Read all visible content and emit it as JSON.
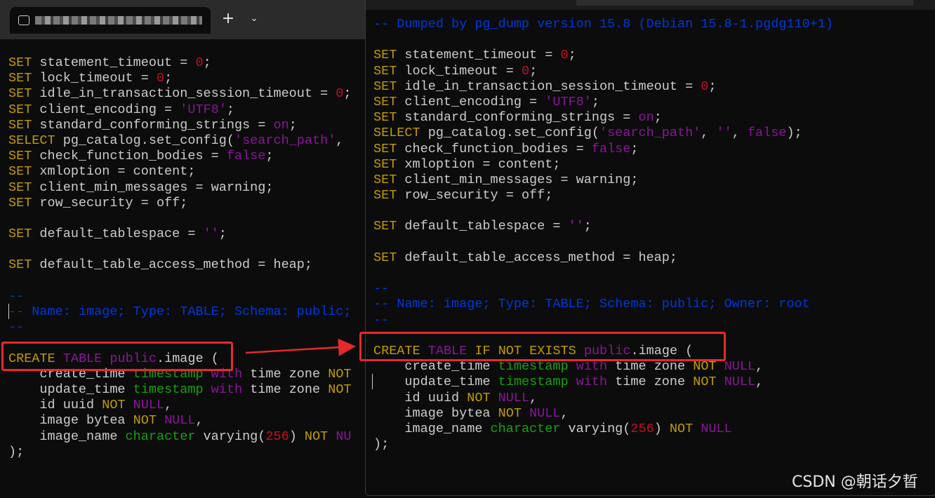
{
  "tabbar": {
    "tab_title": "████████████████████",
    "new_tab_label": "+",
    "dropdown_label": "⌄"
  },
  "colors": {
    "keyword": "#c19c00",
    "number": "#c50f1f",
    "string": "#881798",
    "type": "#13a10e",
    "comment": "#0037da",
    "text": "#cccccc",
    "highlight_box": "#e8282a"
  },
  "left_terminal": {
    "lines": [
      [
        [
          "kw",
          "SET"
        ],
        [
          "t",
          " statement_timeout = "
        ],
        [
          "num",
          "0"
        ],
        [
          "t",
          ";"
        ]
      ],
      [
        [
          "kw",
          "SET"
        ],
        [
          "t",
          " lock_timeout = "
        ],
        [
          "num",
          "0"
        ],
        [
          "t",
          ";"
        ]
      ],
      [
        [
          "kw",
          "SET"
        ],
        [
          "t",
          " idle_in_transaction_session_timeout = "
        ],
        [
          "num",
          "0"
        ],
        [
          "t",
          ";"
        ]
      ],
      [
        [
          "kw",
          "SET"
        ],
        [
          "t",
          " client_encoding = "
        ],
        [
          "str",
          "'UTF8'"
        ],
        [
          "t",
          ";"
        ]
      ],
      [
        [
          "kw",
          "SET"
        ],
        [
          "t",
          " standard_conforming_strings = "
        ],
        [
          "str",
          "on"
        ],
        [
          "t",
          ";"
        ]
      ],
      [
        [
          "kw",
          "SELECT"
        ],
        [
          "t",
          " pg_catalog.set_config("
        ],
        [
          "str",
          "'search_path'"
        ],
        [
          "t",
          ","
        ]
      ],
      [
        [
          "kw",
          "SET"
        ],
        [
          "t",
          " check_function_bodies = "
        ],
        [
          "str",
          "false"
        ],
        [
          "t",
          ";"
        ]
      ],
      [
        [
          "kw",
          "SET"
        ],
        [
          "t",
          " xmloption = content;"
        ]
      ],
      [
        [
          "kw",
          "SET"
        ],
        [
          "t",
          " client_min_messages = warning;"
        ]
      ],
      [
        [
          "kw",
          "SET"
        ],
        [
          "t",
          " row_security = off;"
        ]
      ],
      [],
      [
        [
          "kw",
          "SET"
        ],
        [
          "t",
          " default_tablespace = "
        ],
        [
          "str",
          "''"
        ],
        [
          "t",
          ";"
        ]
      ],
      [],
      [
        [
          "kw",
          "SET"
        ],
        [
          "t",
          " default_table_access_method = heap;"
        ]
      ],
      [],
      [
        [
          "cmt",
          "--"
        ]
      ],
      [
        [
          "cmt",
          "-- Name: image; Type: TABLE; Schema: public;"
        ]
      ],
      [
        [
          "cmt",
          "--"
        ]
      ],
      [],
      [
        [
          "kw",
          "CREATE"
        ],
        [
          "t",
          " "
        ],
        [
          "str",
          "TABLE"
        ],
        [
          "t",
          " "
        ],
        [
          "str",
          "public"
        ],
        [
          "t",
          ".image ("
        ]
      ],
      [
        [
          "t",
          "    create_time "
        ],
        [
          "typ",
          "timestamp"
        ],
        [
          "t",
          " "
        ],
        [
          "str",
          "with"
        ],
        [
          "t",
          " time zone "
        ],
        [
          "kw",
          "NOT"
        ]
      ],
      [
        [
          "t",
          "    update_time "
        ],
        [
          "typ",
          "timestamp"
        ],
        [
          "t",
          " "
        ],
        [
          "str",
          "with"
        ],
        [
          "t",
          " time zone "
        ],
        [
          "kw",
          "NOT"
        ]
      ],
      [
        [
          "t",
          "    id uuid "
        ],
        [
          "kw",
          "NOT"
        ],
        [
          "t",
          " "
        ],
        [
          "str",
          "NULL"
        ],
        [
          "t",
          ","
        ]
      ],
      [
        [
          "t",
          "    image bytea "
        ],
        [
          "kw",
          "NOT"
        ],
        [
          "t",
          " "
        ],
        [
          "str",
          "NULL"
        ],
        [
          "t",
          ","
        ]
      ],
      [
        [
          "t",
          "    image_name "
        ],
        [
          "typ",
          "character"
        ],
        [
          "t",
          " varying("
        ],
        [
          "num",
          "256"
        ],
        [
          "t",
          ") "
        ],
        [
          "kw",
          "NOT"
        ],
        [
          "t",
          " "
        ],
        [
          "str",
          "NU"
        ]
      ],
      [
        [
          "t",
          ");"
        ]
      ]
    ]
  },
  "right_terminal": {
    "lines": [
      [
        [
          "cmt",
          "-- Dumped by pg_dump version 15.8 (Debian 15.8-1.pgdg110+1)"
        ]
      ],
      [],
      [
        [
          "kw",
          "SET"
        ],
        [
          "t",
          " statement_timeout = "
        ],
        [
          "num",
          "0"
        ],
        [
          "t",
          ";"
        ]
      ],
      [
        [
          "kw",
          "SET"
        ],
        [
          "t",
          " lock_timeout = "
        ],
        [
          "num",
          "0"
        ],
        [
          "t",
          ";"
        ]
      ],
      [
        [
          "kw",
          "SET"
        ],
        [
          "t",
          " idle_in_transaction_session_timeout = "
        ],
        [
          "num",
          "0"
        ],
        [
          "t",
          ";"
        ]
      ],
      [
        [
          "kw",
          "SET"
        ],
        [
          "t",
          " client_encoding = "
        ],
        [
          "str",
          "'UTF8'"
        ],
        [
          "t",
          ";"
        ]
      ],
      [
        [
          "kw",
          "SET"
        ],
        [
          "t",
          " standard_conforming_strings = "
        ],
        [
          "str",
          "on"
        ],
        [
          "t",
          ";"
        ]
      ],
      [
        [
          "kw",
          "SELECT"
        ],
        [
          "t",
          " pg_catalog.set_config("
        ],
        [
          "str",
          "'search_path'"
        ],
        [
          "t",
          ", "
        ],
        [
          "str",
          "''"
        ],
        [
          "t",
          ", "
        ],
        [
          "str",
          "false"
        ],
        [
          "t",
          ");"
        ]
      ],
      [
        [
          "kw",
          "SET"
        ],
        [
          "t",
          " check_function_bodies = "
        ],
        [
          "str",
          "false"
        ],
        [
          "t",
          ";"
        ]
      ],
      [
        [
          "kw",
          "SET"
        ],
        [
          "t",
          " xmloption = content;"
        ]
      ],
      [
        [
          "kw",
          "SET"
        ],
        [
          "t",
          " client_min_messages = warning;"
        ]
      ],
      [
        [
          "kw",
          "SET"
        ],
        [
          "t",
          " row_security = off;"
        ]
      ],
      [],
      [
        [
          "kw",
          "SET"
        ],
        [
          "t",
          " default_tablespace = "
        ],
        [
          "str",
          "''"
        ],
        [
          "t",
          ";"
        ]
      ],
      [],
      [
        [
          "kw",
          "SET"
        ],
        [
          "t",
          " default_table_access_method = heap;"
        ]
      ],
      [],
      [
        [
          "cmt",
          "--"
        ]
      ],
      [
        [
          "cmt",
          "-- Name: image; Type: TABLE; Schema: public; Owner: root"
        ]
      ],
      [
        [
          "cmt",
          "--"
        ]
      ],
      [],
      [
        [
          "kw",
          "CREATE"
        ],
        [
          "t",
          " "
        ],
        [
          "str",
          "TABLE"
        ],
        [
          "t",
          " "
        ],
        [
          "kw",
          "IF"
        ],
        [
          "t",
          " "
        ],
        [
          "kw",
          "NOT"
        ],
        [
          "t",
          " "
        ],
        [
          "kw",
          "EXISTS"
        ],
        [
          "t",
          " "
        ],
        [
          "str",
          "public"
        ],
        [
          "t",
          ".image ("
        ]
      ],
      [
        [
          "t",
          "    create_time "
        ],
        [
          "typ",
          "timestamp"
        ],
        [
          "t",
          " "
        ],
        [
          "str",
          "with"
        ],
        [
          "t",
          " time zone "
        ],
        [
          "kw",
          "NOT"
        ],
        [
          "t",
          " "
        ],
        [
          "str",
          "NULL"
        ],
        [
          "t",
          ","
        ]
      ],
      [
        [
          "t",
          "    update_time "
        ],
        [
          "typ",
          "timestamp"
        ],
        [
          "t",
          " "
        ],
        [
          "str",
          "with"
        ],
        [
          "t",
          " time zone "
        ],
        [
          "kw",
          "NOT"
        ],
        [
          "t",
          " "
        ],
        [
          "str",
          "NULL"
        ],
        [
          "t",
          ","
        ]
      ],
      [
        [
          "t",
          "    id uuid "
        ],
        [
          "kw",
          "NOT"
        ],
        [
          "t",
          " "
        ],
        [
          "str",
          "NULL"
        ],
        [
          "t",
          ","
        ]
      ],
      [
        [
          "t",
          "    image bytea "
        ],
        [
          "kw",
          "NOT"
        ],
        [
          "t",
          " "
        ],
        [
          "str",
          "NULL"
        ],
        [
          "t",
          ","
        ]
      ],
      [
        [
          "t",
          "    image_name "
        ],
        [
          "typ",
          "character"
        ],
        [
          "t",
          " varying("
        ],
        [
          "num",
          "256"
        ],
        [
          "t",
          ") "
        ],
        [
          "kw",
          "NOT"
        ],
        [
          "t",
          " "
        ],
        [
          "str",
          "NULL"
        ]
      ],
      [
        [
          "t",
          ");"
        ]
      ]
    ]
  },
  "watermark": "CSDN @朝话夕晢"
}
